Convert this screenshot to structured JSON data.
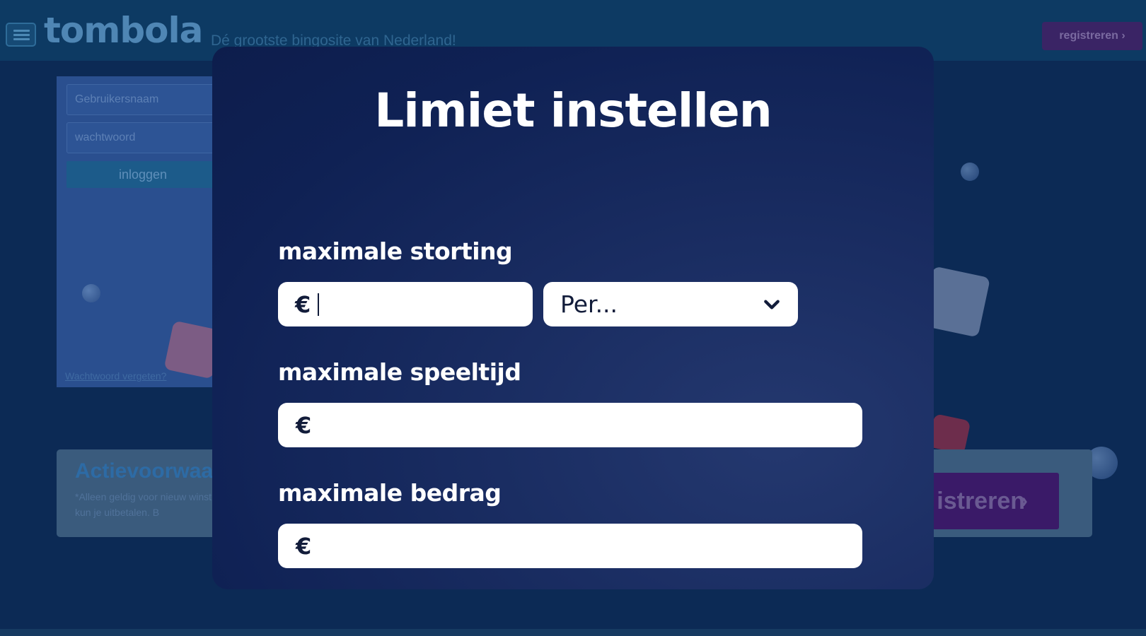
{
  "site": {
    "logo": "tombola",
    "tagline": "Dé grootste bingosite van Nederland!",
    "register_top": "registreren",
    "login": {
      "username_placeholder": "Gebruikersnaam",
      "password_placeholder": "wachtwoord",
      "login_button": "inloggen",
      "forgot_link": "Wachtwoord vergeten?"
    },
    "promo": {
      "title": "Actievoorwaa",
      "text": "*Alleen geldig voor nieuw winst kun je uitbetalen. B",
      "register_button": "istreren"
    }
  },
  "modal": {
    "title": "Limiet instellen",
    "deposit": {
      "label": "maximale storting",
      "currency": "€",
      "period_placeholder": "Per..."
    },
    "playtime": {
      "label": "maximale speeltijd",
      "currency": "€"
    },
    "amount": {
      "label": "maximale bedrag",
      "currency": "€"
    }
  },
  "icons": {
    "menu": "hamburger-menu-icon",
    "dropdown": "chevron-down-icon",
    "next": "chevron-right-icon"
  },
  "colors": {
    "modal_bg": "#0f2154",
    "input_bg": "#ffffff",
    "text_dark": "#121c3a",
    "register_purple": "#3a1a68"
  }
}
